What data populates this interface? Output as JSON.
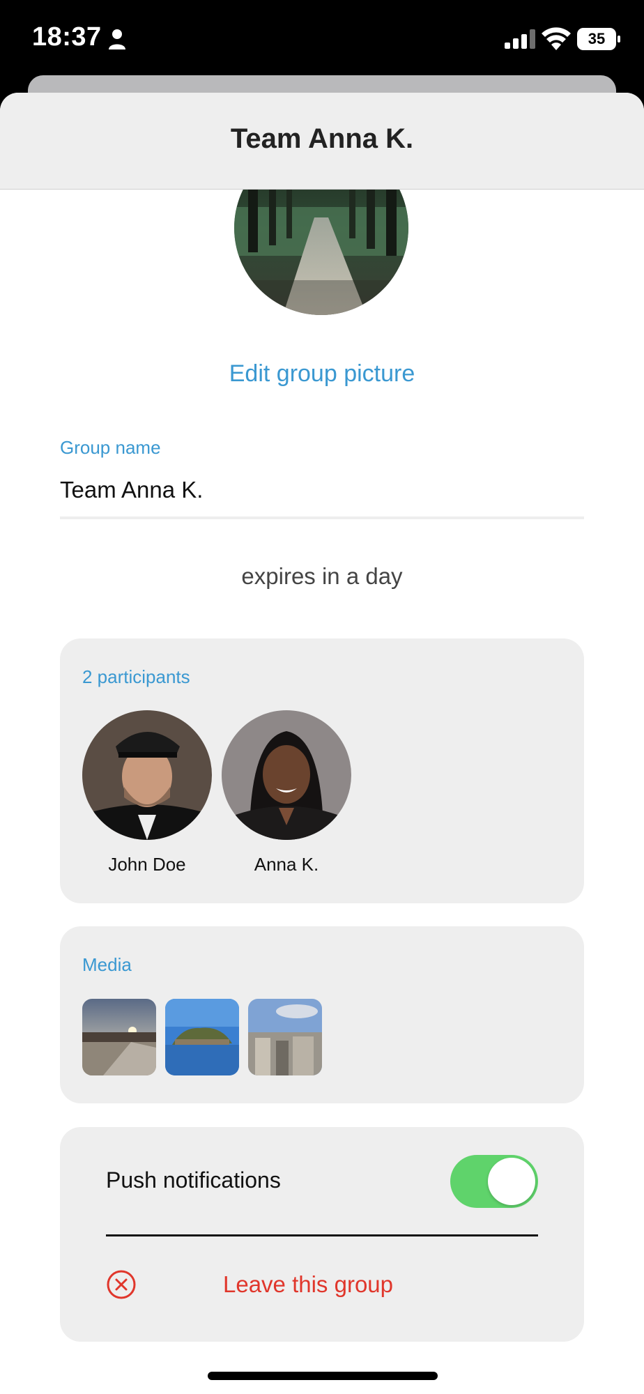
{
  "status_bar": {
    "time": "18:37",
    "battery": "35",
    "icons": [
      "person-icon",
      "signal-icon",
      "wifi-icon",
      "battery-icon"
    ]
  },
  "header": {
    "title": "Team Anna K."
  },
  "group": {
    "picture_alt": "forest path",
    "edit_picture_label": "Edit group picture",
    "name_label": "Group name",
    "name_value": "Team Anna K.",
    "expires_text": "expires in a day"
  },
  "participants": {
    "label": "2 participants",
    "items": [
      {
        "name": "John Doe"
      },
      {
        "name": "Anna K."
      }
    ]
  },
  "media": {
    "label": "Media",
    "items": [
      {
        "description": "harbor at sunset"
      },
      {
        "description": "island on river"
      },
      {
        "description": "city rooftops"
      }
    ]
  },
  "settings": {
    "push_label": "Push notifications",
    "push_enabled": true,
    "leave_label": "Leave this group"
  },
  "colors": {
    "accent": "#3a98d1",
    "toggle_on": "#5fd36b",
    "danger": "#e0362b",
    "card_bg": "#eeeeee"
  }
}
